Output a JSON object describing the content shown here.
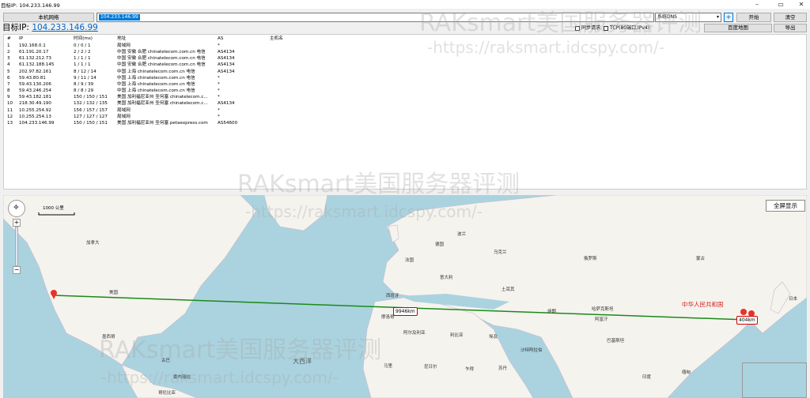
{
  "window": {
    "title": "目标IP: 104.233.146.99",
    "minimize": "–",
    "restore": "▭",
    "close": "✕"
  },
  "toolbar": {
    "local_network": "本机网络",
    "ip_value": "104.233.146.99",
    "dns_select": "系统DNS",
    "add": "+",
    "start": "开始",
    "clear": "清空",
    "sync_request": "同步请求",
    "tcp_option": "TCP(80端口,IPv4)",
    "baidu_map": "百度地图",
    "export": "导出"
  },
  "target": {
    "label": "目标IP:",
    "ip": "104.233.146.99"
  },
  "table": {
    "headers": [
      "#",
      "IP",
      "时间(ms)",
      "地址",
      "AS",
      "主机名"
    ],
    "rows": [
      [
        "1",
        "192.168.0.1",
        "0 / 0 / 1",
        "局域网",
        "*",
        ""
      ],
      [
        "2",
        "61.191.20.17",
        "2 / 2 / 2",
        "中国 安徽 合肥 chinatelecom.com.cn 电信",
        "AS4134",
        ""
      ],
      [
        "3",
        "61.132.212.73",
        "1 / 1 / 1",
        "中国 安徽 合肥 chinatelecom.com.cn 电信",
        "AS4134",
        ""
      ],
      [
        "4",
        "61.132.188.145",
        "1 / 1 / 1",
        "中国 安徽 合肥 chinatelecom.com.cn 电信",
        "AS4134",
        ""
      ],
      [
        "5",
        "202.97.82.161",
        "8 / 12 / 14",
        "中国 上海 chinatelecom.com.cn 电信",
        "AS4134",
        ""
      ],
      [
        "6",
        "59.43.80.81",
        "9 / 11 / 14",
        "中国 上海 chinatelecom.com.cn 电信",
        "*",
        ""
      ],
      [
        "7",
        "59.43.130.206",
        "8 / 9 / 39",
        "中国 上海 chinatelecom.com.cn 电信",
        "*",
        ""
      ],
      [
        "8",
        "59.43.246.254",
        "8 / 8 / 29",
        "中国 上海 chinatelecom.com.cn 电信",
        "*",
        ""
      ],
      [
        "9",
        "59.43.182.181",
        "150 / 150 / 151",
        "美国 加利福尼亚州 圣何塞 chinatelecom.c...",
        "*",
        ""
      ],
      [
        "10",
        "218.30.49.190",
        "132 / 132 / 135",
        "美国 加利福尼亚州 圣何塞 chinatelecom.c...",
        "AS4134",
        ""
      ],
      [
        "11",
        "10.255.254.92",
        "156 / 157 / 157",
        "局域网",
        "*",
        ""
      ],
      [
        "12",
        "10.255.254.13",
        "127 / 127 / 127",
        "局域网",
        "*",
        ""
      ],
      [
        "13",
        "104.233.146.99",
        "150 / 150 / 151",
        "美国 加利福尼亚州 圣何塞 petaexpress.com",
        "AS54600",
        ""
      ]
    ]
  },
  "map": {
    "fullscreen": "全屏显示",
    "scale": "1000 公里",
    "distance_1": "9946km",
    "distance_2": "404km",
    "labels": [
      {
        "text": "加拿大"
      },
      {
        "text": "美国"
      },
      {
        "text": "墨西哥"
      },
      {
        "text": "大西洋"
      },
      {
        "text": "法国"
      },
      {
        "text": "德国"
      },
      {
        "text": "西班牙"
      },
      {
        "text": "意大利"
      },
      {
        "text": "波兰"
      },
      {
        "text": "乌克兰"
      },
      {
        "text": "俄罗斯"
      },
      {
        "text": "土耳其"
      },
      {
        "text": "伊朗"
      },
      {
        "text": "哈萨克斯坦"
      },
      {
        "text": "蒙古"
      },
      {
        "text": "中华人民共和国"
      },
      {
        "text": "阿尔及利亚"
      },
      {
        "text": "利比亚"
      },
      {
        "text": "埃及"
      },
      {
        "text": "沙特阿拉伯"
      },
      {
        "text": "马里"
      },
      {
        "text": "尼日尔"
      },
      {
        "text": "乍得"
      },
      {
        "text": "苏丹"
      },
      {
        "text": "摩洛哥"
      },
      {
        "text": "古巴"
      },
      {
        "text": "委内瑞拉"
      },
      {
        "text": "哥伦比亚"
      },
      {
        "text": "印度"
      },
      {
        "text": "巴基斯坦"
      },
      {
        "text": "阿富汗"
      },
      {
        "text": "缅甸"
      },
      {
        "text": "西班牙"
      },
      {
        "text": "日本"
      }
    ]
  },
  "watermark": {
    "brand": "RAKsmart美国服务器评测",
    "url": "-https://raksmart.idcspy.com/-"
  },
  "colors": {
    "route_line": "#1a8a1a",
    "link": "#0066cc",
    "selection": "#0078d7",
    "marker": "#e8332b",
    "china_label": "#d62020"
  }
}
